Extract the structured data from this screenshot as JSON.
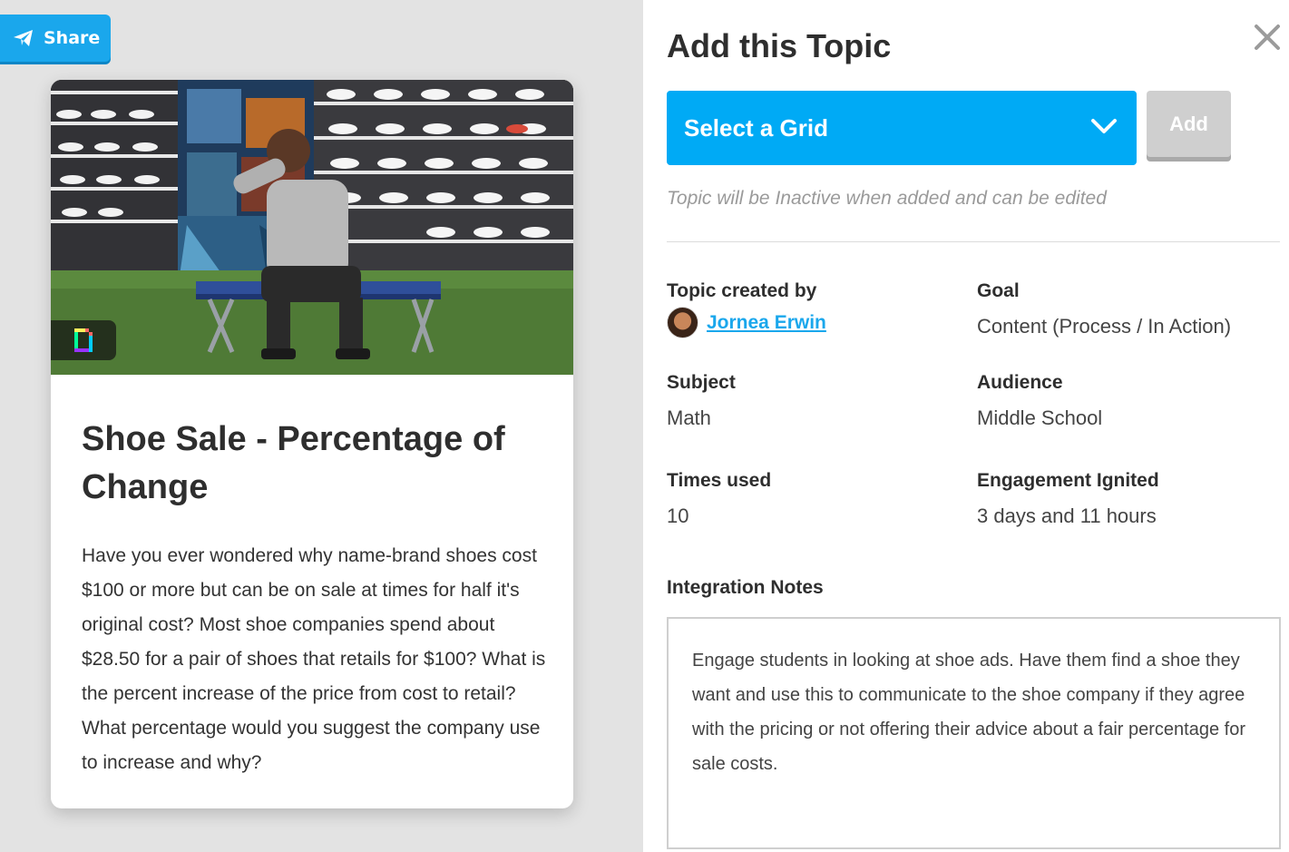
{
  "share": {
    "label": "Share",
    "icon": "paper-plane-icon"
  },
  "card": {
    "title": "Shoe Sale - Percentage of Change",
    "description": "Have you ever wondered why name-brand shoes cost $100 or more but can be on sale at times for half it's original cost?  Most shoe companies spend about $28.50 for a pair of shoes that retails for $100? What is the percent increase of the price from cost to retail?  What percentage would you suggest the company use to increase and why?",
    "badge_icon": "giphy-icon"
  },
  "panel": {
    "title": "Add this Topic",
    "select_label": "Select a Grid",
    "add_label": "Add",
    "hint": "Topic will be Inactive when added and can be edited",
    "close_icon": "close-icon"
  },
  "meta": {
    "created_by_label": "Topic created by",
    "creator_name": "Jornea Erwin",
    "goal_label": "Goal",
    "goal_value": "Content (Process / In Action)",
    "subject_label": "Subject",
    "subject_value": "Math",
    "audience_label": "Audience",
    "audience_value": "Middle School",
    "times_used_label": "Times used",
    "times_used_value": "10",
    "engagement_label": "Engagement Ignited",
    "engagement_value": "3 days and 11 hours"
  },
  "notes": {
    "label": "Integration Notes",
    "text": "Engage students in looking at shoe ads.  Have them find a shoe they want and use this to communicate to the shoe company if they agree with the pricing or not offering their advice about a fair percentage for sale costs."
  },
  "colors": {
    "accent": "#00aaf5",
    "share": "#1aa7ec",
    "link": "#1aa7ec",
    "disabled": "#cfcfcf"
  }
}
